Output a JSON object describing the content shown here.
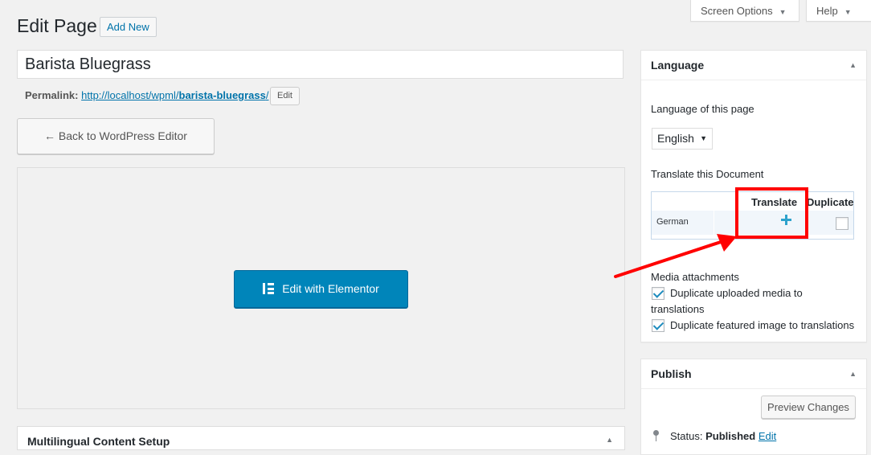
{
  "top_tabs": {
    "screen_options": "Screen Options",
    "help": "Help"
  },
  "header": {
    "title": "Edit Page",
    "add_new": "Add New"
  },
  "post": {
    "title_value": "Barista Bluegrass",
    "permalink_label": "Permalink:",
    "permalink_base": "http://localhost/wpml/",
    "permalink_slug": "barista-bluegrass",
    "permalink_end": "/",
    "edit_label": "Edit"
  },
  "editor": {
    "back_label": "← Back to WordPress Editor",
    "elementor_label": "Edit with Elementor",
    "multilingual_label": "Multilingual Content Setup"
  },
  "language_box": {
    "title": "Language",
    "lang_label": "Language of this page",
    "selected_language": "English",
    "translate_doc_label": "Translate this Document",
    "col_translate": "Translate",
    "col_duplicate": "Duplicate",
    "rows": [
      {
        "language": "German",
        "translate_icon": "plus-icon",
        "duplicate_checked": false
      }
    ],
    "media_label": "Media attachments",
    "media_opt1_line1": "Duplicate uploaded media to",
    "media_opt1_line2": "translations",
    "media_opt1_checked": true,
    "media_opt2": "Duplicate featured image to translations",
    "media_opt2_checked": true
  },
  "publish_box": {
    "title": "Publish",
    "preview_label": "Preview Changes",
    "status_label": "Status:",
    "status_value": "Published",
    "status_edit": "Edit"
  },
  "colors": {
    "accent": "#0073aa",
    "primary_button": "#0085ba",
    "annotation": "#ff0000"
  }
}
